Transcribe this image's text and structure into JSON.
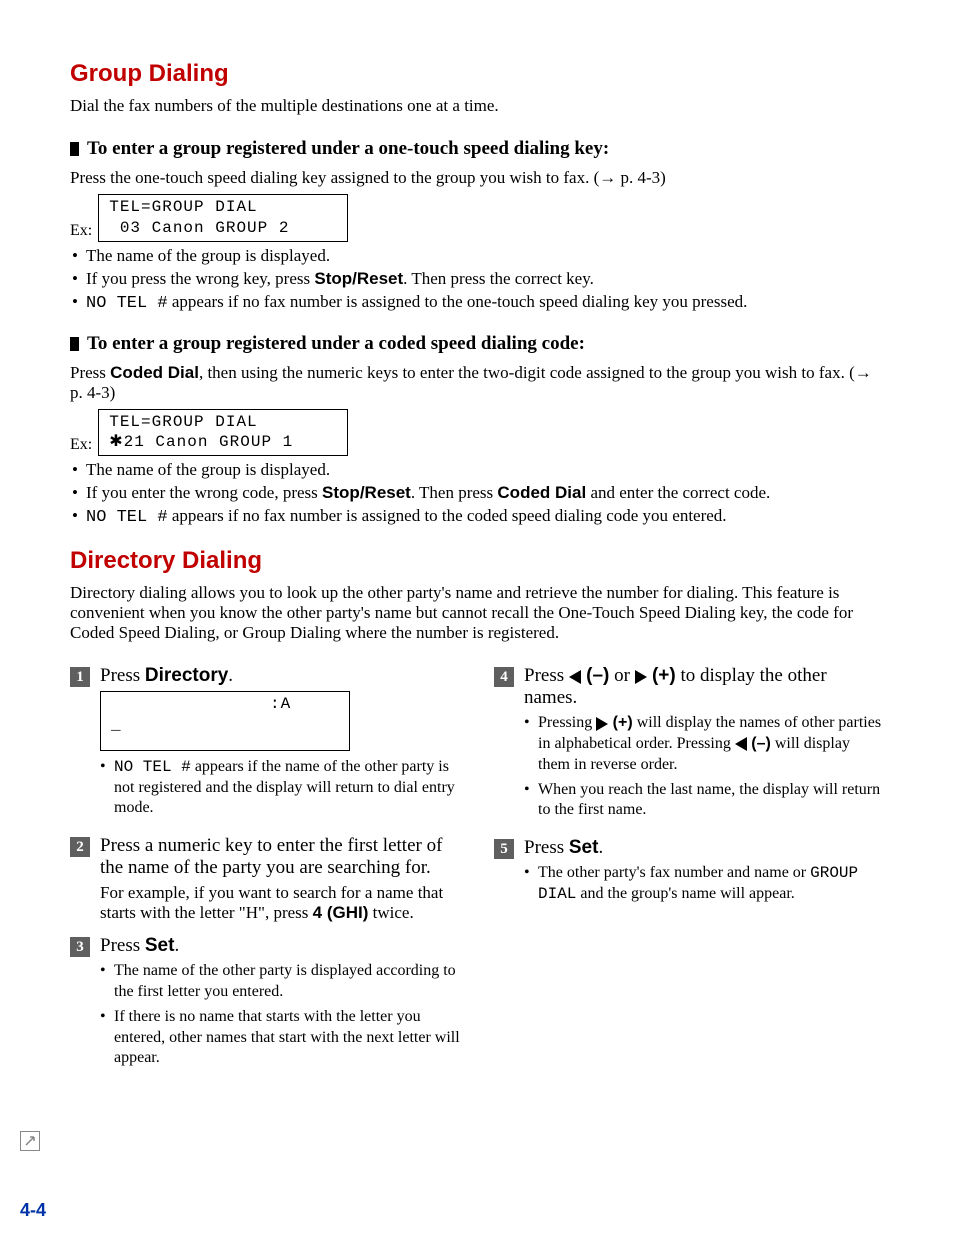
{
  "section1": {
    "title": "Group Dialing",
    "intro": "Dial the fax numbers of the multiple destinations one at a time.",
    "sub1": {
      "title": "To enter a group registered under a one-touch speed dialing key:",
      "para_a": "Press the one-touch speed dialing key assigned to the group you wish to fax. (",
      "para_ref": " p. 4-3)",
      "ex_label": "Ex:",
      "lcd_l1": "TEL=GROUP DIAL",
      "lcd_l2": " 03 Canon GROUP 2",
      "b1": "The name of the group is displayed.",
      "b2_a": "If you press the wrong key, press ",
      "b2_b": "Stop/Reset",
      "b2_c": ". Then press the correct key.",
      "b3_a": "NO TEL #",
      "b3_b": " appears if no fax number is assigned to the one-touch speed dialing key you pressed."
    },
    "sub2": {
      "title": "To enter a group registered under a coded speed dialing code:",
      "para_a": "Press ",
      "para_b": "Coded Dial",
      "para_c": ", then using the numeric keys to enter the two-digit code assigned to the group you wish to fax. (",
      "para_ref": " p. 4-3)",
      "ex_label": "Ex:",
      "lcd_l1": "TEL=GROUP DIAL",
      "lcd_l2": "✱21 Canon GROUP 1",
      "b1": "The name of the group is displayed.",
      "b2_a": "If you enter the wrong code, press ",
      "b2_b": "Stop/Reset",
      "b2_c": ". Then press ",
      "b2_d": "Coded Dial",
      "b2_e": " and enter the correct code.",
      "b3_a": "NO TEL #",
      "b3_b": " appears if no fax number is assigned to the coded speed dialing code you entered."
    }
  },
  "section2": {
    "title": "Directory Dialing",
    "intro": "Directory dialing allows you to look up the other party's name and retrieve the number for dialing. This feature is convenient when you know the other party's name but cannot recall the One-Touch Speed Dialing key, the code for Coded Speed Dialing, or Group Dialing where the number is registered.",
    "steps": {
      "s1": {
        "num": "1",
        "head_a": "Press ",
        "head_b": "Directory",
        "head_c": ".",
        "lcd_l1": "               :A",
        "lcd_l2": "_",
        "b1_a": "NO TEL #",
        "b1_b": " appears if the name of the other party is not registered and the display will return to dial entry mode."
      },
      "s2": {
        "num": "2",
        "head": "Press a numeric key to enter the first letter of the name of the party you are searching for.",
        "sub_a": "For example, if you want to search for a name that starts with the letter \"H\", press ",
        "sub_b": "4 (GHI)",
        "sub_c": " twice."
      },
      "s3": {
        "num": "3",
        "head_a": "Press ",
        "head_b": "Set",
        "head_c": ".",
        "b1": "The name of the other party is displayed according to the first letter you entered.",
        "b2": "If there is no name that starts with the letter you entered, other names that start with the next letter will appear."
      },
      "s4": {
        "num": "4",
        "head_a": "Press ",
        "head_minus": " (–)",
        "head_or": " or ",
        "head_plus": " (+)",
        "head_b": " to display the other names.",
        "b1_a": "Pressing ",
        "b1_plus": " (+)",
        "b1_b": " will display the names of other parties in alphabetical order. Pressing ",
        "b1_minus": " (–)",
        "b1_c": " will display them in reverse order.",
        "b2": "When you reach the last name, the display will return to the first name."
      },
      "s5": {
        "num": "5",
        "head_a": "Press ",
        "head_b": "Set",
        "head_c": ".",
        "b1_a": "The other party's fax number and name or ",
        "b1_b": "GROUP DIAL",
        "b1_c": " and the group's name will appear."
      }
    }
  },
  "page_number": "4-4"
}
